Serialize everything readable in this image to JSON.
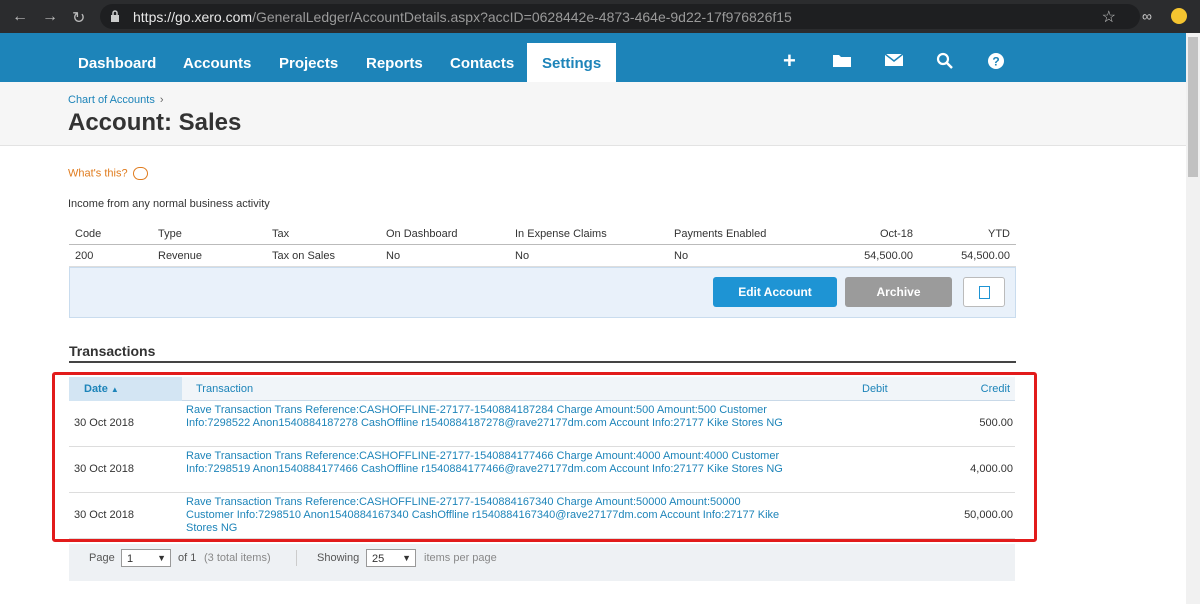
{
  "browser": {
    "url_host": "https://go.xero.com",
    "url_path": "/GeneralLedger/AccountDetails.aspx?accID=0628442e-4873-464e-9d22-17f976826f15"
  },
  "nav": {
    "tabs": [
      "Dashboard",
      "Accounts",
      "Projects",
      "Reports",
      "Contacts",
      "Settings"
    ],
    "active_tab": "Settings"
  },
  "header": {
    "breadcrumb": "Chart of Accounts",
    "breadcrumb_sep": "›",
    "title": "Account: Sales"
  },
  "whats_this": "What's this?",
  "description": "Income from any normal business activity",
  "account_table": {
    "headers": [
      "Code",
      "Type",
      "Tax",
      "On Dashboard",
      "In Expense Claims",
      "Payments Enabled",
      "Oct-18",
      "YTD"
    ],
    "row": [
      "200",
      "Revenue",
      "Tax on Sales",
      "No",
      "No",
      "No",
      "54,500.00",
      "54,500.00"
    ]
  },
  "buttons": {
    "edit": "Edit Account",
    "archive": "Archive"
  },
  "transactions": {
    "heading": "Transactions",
    "headers": {
      "date": "Date",
      "sort_glyph": "▲",
      "transaction": "Transaction",
      "debit": "Debit",
      "credit": "Credit"
    },
    "rows": [
      {
        "date": "30 Oct 2018",
        "text": "Rave Transaction Trans Reference:CASHOFFLINE-27177-1540884187284 Charge Amount:500 Amount:500 Customer Info:7298522 Anon1540884187278 CashOffline r1540884187278@rave27177dm.com Account Info:27177 Kike Stores NG",
        "debit": "",
        "credit": "500.00"
      },
      {
        "date": "30 Oct 2018",
        "text": "Rave Transaction Trans Reference:CASHOFFLINE-27177-1540884177466 Charge Amount:4000 Amount:4000 Customer Info:7298519 Anon1540884177466 CashOffline r1540884177466@rave27177dm.com Account Info:27177 Kike Stores NG",
        "debit": "",
        "credit": "4,000.00"
      },
      {
        "date": "30 Oct 2018",
        "text": "Rave Transaction Trans Reference:CASHOFFLINE-27177-1540884167340 Charge Amount:50000 Amount:50000 Customer Info:7298510 Anon1540884167340 CashOffline r1540884167340@rave27177dm.com Account Info:27177 Kike Stores NG",
        "debit": "",
        "credit": "50,000.00"
      }
    ]
  },
  "pager": {
    "page_label": "Page",
    "page_value": "1",
    "of_label": "of 1",
    "total": "(3 total items)",
    "showing_label": "Showing",
    "per_page_value": "25",
    "per_page_label": "items per page"
  },
  "colors": {
    "brand": "#1d84b9",
    "highlight": "#e21b1b"
  },
  "icons": [
    "plus-icon",
    "folder-icon",
    "mail-icon",
    "search-icon",
    "help-icon"
  ]
}
